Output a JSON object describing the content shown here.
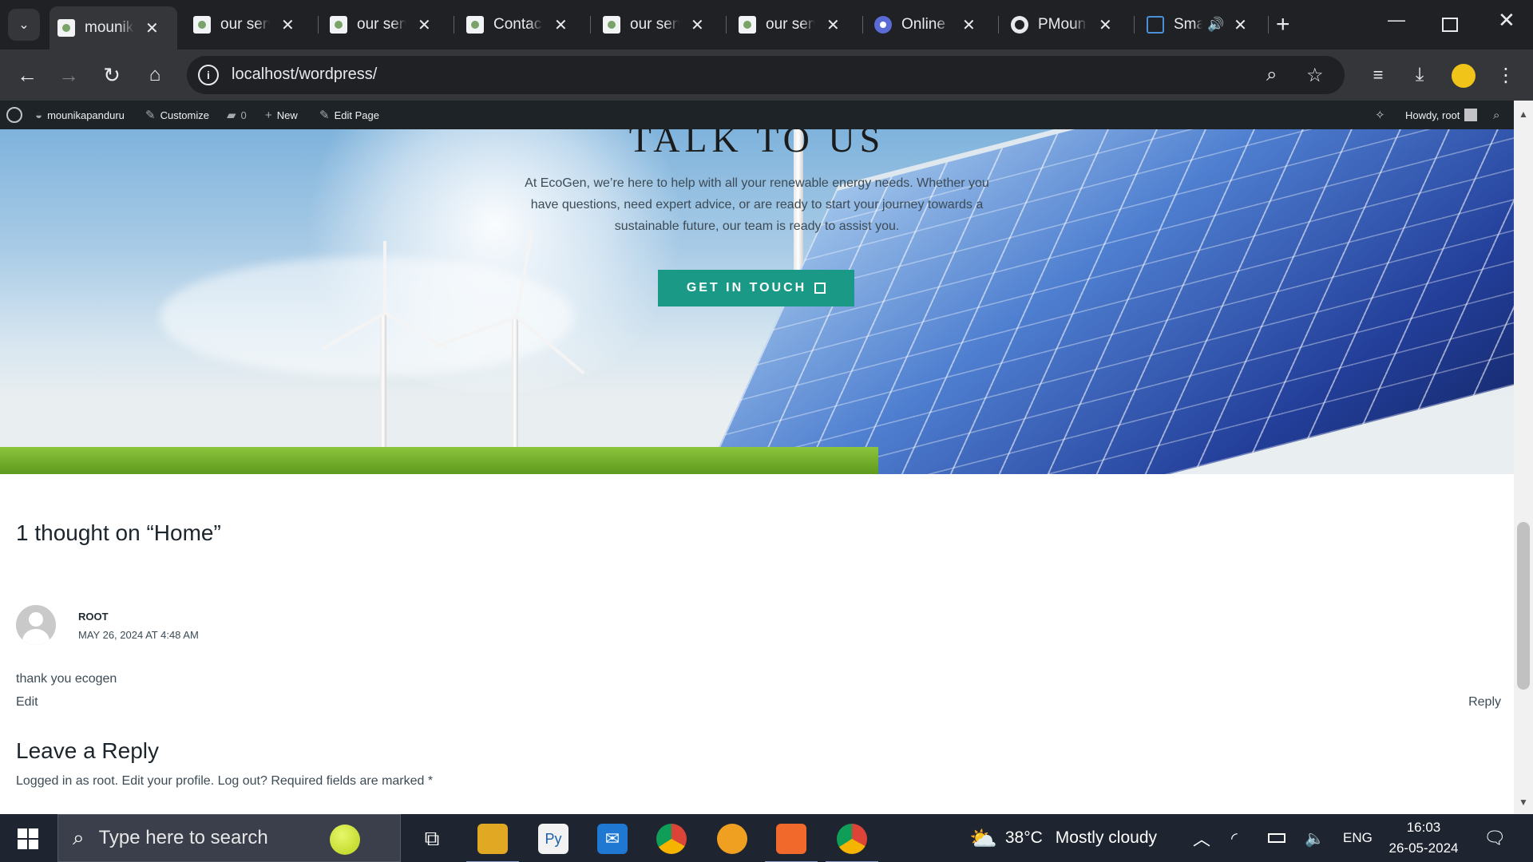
{
  "browser": {
    "tabs": [
      {
        "title": "mounikapanduru",
        "active": true
      },
      {
        "title": "our services"
      },
      {
        "title": "our services"
      },
      {
        "title": "Contact"
      },
      {
        "title": "our services"
      },
      {
        "title": "our services"
      },
      {
        "title": "Online C"
      },
      {
        "title": "PMounika"
      },
      {
        "title": "Smart"
      }
    ],
    "url": "localhost/wordpress/"
  },
  "adminbar": {
    "site": "mounikapanduru",
    "customize": "Customize",
    "comments_count": "0",
    "new": "New",
    "edit_page": "Edit Page",
    "howdy": "Howdy, root"
  },
  "hero": {
    "title": "TALK TO US",
    "description": "At EcoGen, we’re here to help with all your renewable energy needs. Whether you have questions, need expert advice, or are ready to start your journey towards a sustainable future, our team is ready to assist you.",
    "cta": "GET IN TOUCH",
    "accent": "#1a9a86"
  },
  "comments": {
    "heading": "1 thought on “Home”",
    "items": [
      {
        "author": "ROOT",
        "date": "MAY 26, 2024 AT 4:48 AM",
        "body": "thank you ecogen",
        "edit": "Edit",
        "reply": "Reply"
      }
    ],
    "reply_heading": "Leave a Reply",
    "reply_note": "Logged in as root. Edit your profile. Log out? Required fields are marked *"
  },
  "taskbar": {
    "search_placeholder": "Type here to search",
    "weather_temp": "38°C",
    "weather_text": "Mostly cloudy",
    "language": "ENG",
    "time": "16:03",
    "date": "26-05-2024"
  }
}
